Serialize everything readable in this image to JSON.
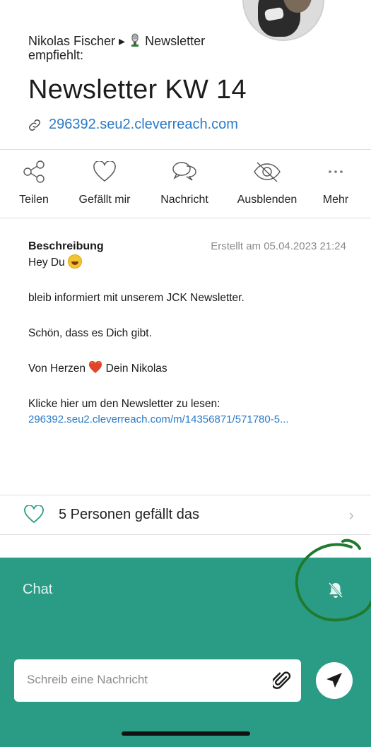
{
  "post": {
    "recommender_prefix": "Nikolas Fischer ▸",
    "recommender_suffix": "Newsletter empfiehlt:",
    "title": "Newsletter KW 14",
    "link": "296392.seu2.cleverreach.com"
  },
  "actions": [
    {
      "label": "Teilen",
      "icon": "share-icon"
    },
    {
      "label": "Gefällt mir",
      "icon": "heart-icon"
    },
    {
      "label": "Nachricht",
      "icon": "chat-bubbles-icon"
    },
    {
      "label": "Ausblenden",
      "icon": "eye-off-icon"
    },
    {
      "label": "Mehr",
      "icon": "more-icon"
    }
  ],
  "description": {
    "heading": "Beschreibung",
    "created": "Erstellt am 05.04.2023 21:24",
    "greeting": "Hey Du",
    "line1": "bleib informiert mit unserem JCK Newsletter.",
    "line2": "Schön, dass es Dich gibt.",
    "sign_prefix": "Von Herzen",
    "sign_suffix": "Dein Nikolas",
    "read_prompt": "Klicke hier um den Newsletter zu lesen:",
    "read_link": "296392.seu2.cleverreach.com/m/14356871/571780-5..."
  },
  "likes": {
    "text": "5 Personen gefällt das"
  },
  "chat": {
    "title": "Chat",
    "placeholder": "Schreib eine Nachricht"
  },
  "colors": {
    "accent": "#2a9c86",
    "link": "#2a7ac7",
    "annotation": "#1f7a2e"
  }
}
